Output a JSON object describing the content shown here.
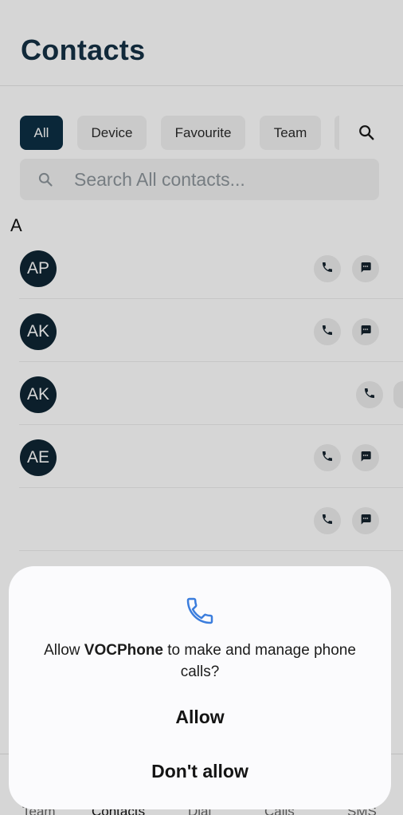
{
  "header": {
    "title": "Contacts"
  },
  "filters": {
    "chips": [
      "All",
      "Device",
      "Favourite",
      "Team"
    ],
    "active": "All"
  },
  "search": {
    "placeholder": "Search All contacts..."
  },
  "section_letter": "A",
  "contacts": [
    {
      "initials": "AP"
    },
    {
      "initials": "AK"
    },
    {
      "initials": "AK"
    },
    {
      "initials": "AE"
    },
    {
      "initials": ""
    }
  ],
  "bottom_nav": [
    "Team",
    "Contacts",
    "Dial",
    "Calls",
    "SMS"
  ],
  "dialog": {
    "prefix": "Allow ",
    "app_name": "VOCPhone",
    "suffix": " to make and manage phone calls?",
    "allow": "Allow",
    "deny": "Don't allow"
  },
  "colors": {
    "brand_dark": "#0d2f44",
    "dialog_icon": "#3b7ddd"
  },
  "icons": {
    "filter_search": "search-icon",
    "search_bar": "search-icon",
    "call": "phone-icon",
    "message": "message-icon",
    "dialog": "phone-icon"
  }
}
